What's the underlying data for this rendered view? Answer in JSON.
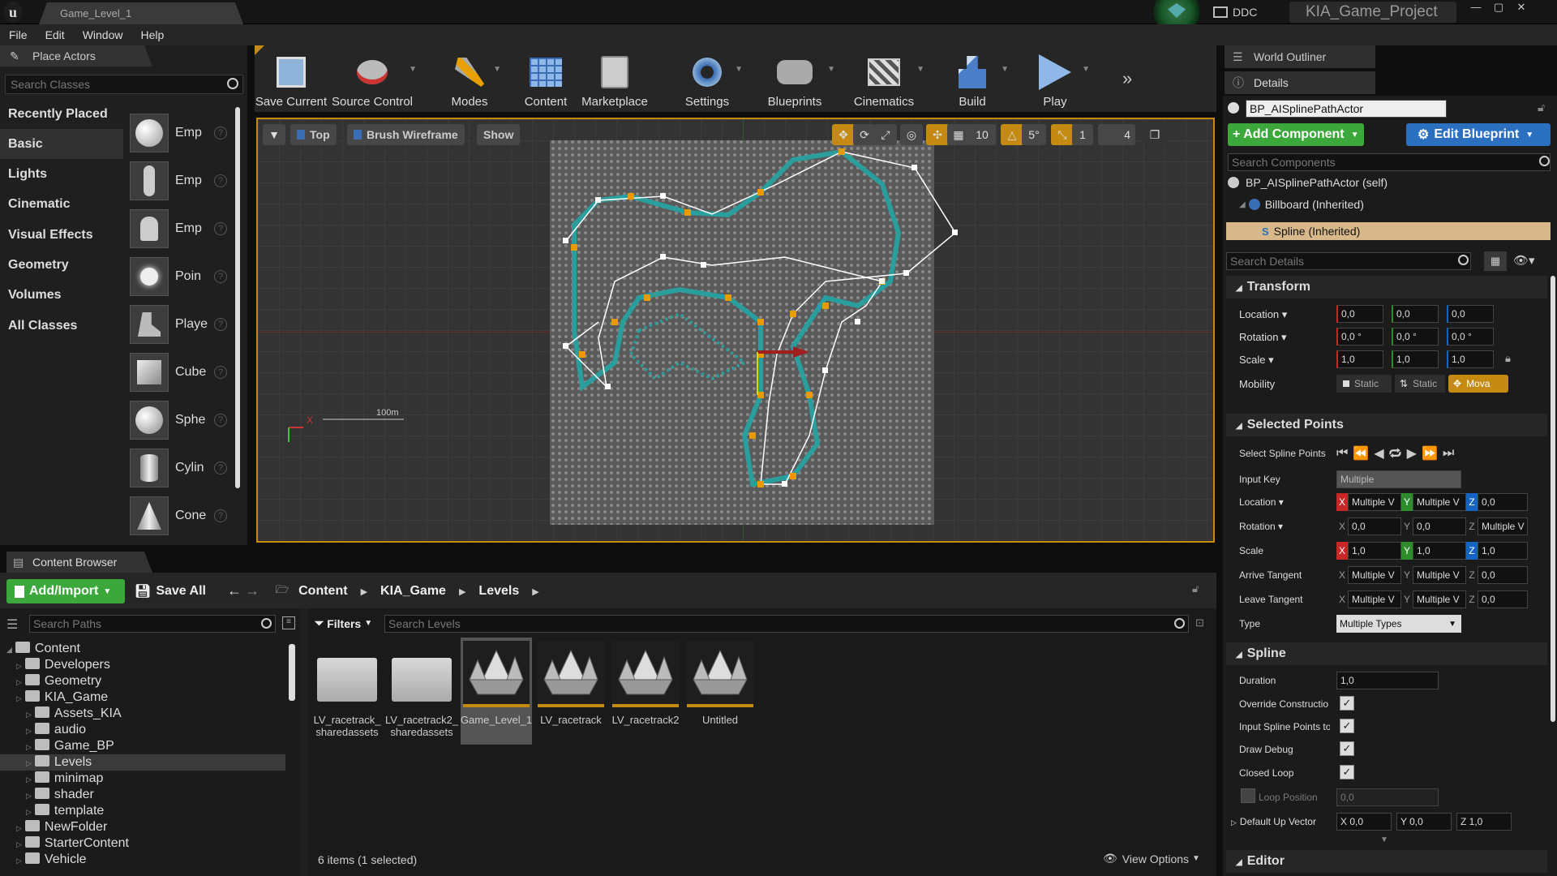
{
  "title_bar": {
    "doc_tab": "Game_Level_1",
    "ddc": "DDC",
    "project": "KIA_Game_Project"
  },
  "menu": [
    "File",
    "Edit",
    "Window",
    "Help"
  ],
  "place_actors": {
    "tab": "Place Actors",
    "search_placeholder": "Search Classes",
    "categories": [
      "Recently Placed",
      "Basic",
      "Lights",
      "Cinematic",
      "Visual Effects",
      "Geometry",
      "Volumes",
      "All Classes"
    ],
    "active_category": "Basic",
    "actors": [
      "Emp",
      "Emp",
      "Emp",
      "Poin",
      "Playe",
      "Cube",
      "Sphe",
      "Cylin",
      "Cone"
    ]
  },
  "toolbar": {
    "items": [
      "Save Current",
      "Source Control",
      "Modes",
      "Content",
      "Marketplace",
      "Settings",
      "Blueprints",
      "Cinematics",
      "Build",
      "Play"
    ]
  },
  "viewport": {
    "view_mode": "Top",
    "render_mode": "Brush Wireframe",
    "show": "Show",
    "grid_snap": "10",
    "rot_snap": "5°",
    "scale_snap": "1",
    "cam_speed": "4",
    "scale_label": "100m",
    "axis_x": "X"
  },
  "right": {
    "outliner_tab": "World Outliner",
    "details_tab": "Details",
    "actor_name": "BP_AISplinePathActor",
    "add_component": "+ Add Component",
    "edit_blueprint": "Edit Blueprint",
    "search_components": "Search Components",
    "components": [
      "BP_AISplinePathActor (self)",
      "Billboard (Inherited)",
      "Spline (Inherited)"
    ],
    "search_details": "Search Details",
    "transform": {
      "title": "Transform",
      "location_label": "Location",
      "rotation_label": "Rotation",
      "scale_label": "Scale",
      "mobility_label": "Mobility",
      "location": [
        "0,0",
        "0,0",
        "0,0"
      ],
      "rotation": [
        "0,0 °",
        "0,0 °",
        "0,0 °"
      ],
      "scale": [
        "1,0",
        "1,0",
        "1,0"
      ],
      "mobility": [
        "Static",
        "Static",
        "Mova"
      ]
    },
    "selected_points": {
      "title": "Selected Points",
      "select_label": "Select Spline Points",
      "input_key_label": "Input Key",
      "input_key": "Multiple",
      "location_label": "Location",
      "rotation_label": "Rotation",
      "scale_label": "Scale",
      "arrive_label": "Arrive Tangent",
      "leave_label": "Leave Tangent",
      "type_label": "Type",
      "location": [
        "Multiple V",
        "Multiple V",
        "0,0"
      ],
      "rotation": [
        "0,0",
        "0,0",
        "Multiple V"
      ],
      "scale": [
        "1,0",
        "1,0",
        "1,0"
      ],
      "arrive": [
        "Multiple V",
        "Multiple V",
        "0,0"
      ],
      "leave": [
        "Multiple V",
        "Multiple V",
        "0,0"
      ],
      "type": "Multiple Types"
    },
    "spline": {
      "title": "Spline",
      "duration_label": "Duration",
      "duration": "1,0",
      "override_label": "Override Constructio",
      "input_points_label": "Input Spline Points to",
      "draw_debug_label": "Draw Debug",
      "closed_loop_label": "Closed Loop",
      "loop_position_label": "Loop Position",
      "loop_position": "0,0",
      "up_vector_label": "Default Up Vector",
      "up_vector": [
        "X 0,0",
        "Y 0,0",
        "Z 1,0"
      ]
    },
    "editor": {
      "title": "Editor"
    }
  },
  "content_browser": {
    "tab": "Content Browser",
    "add_import": "Add/Import",
    "save_all": "Save All",
    "breadcrumbs": [
      "Content",
      "KIA_Game",
      "Levels"
    ],
    "search_paths": "Search Paths",
    "filters": "Filters",
    "search_levels": "Search Levels",
    "tree": [
      {
        "label": "Content",
        "indent": 0,
        "sel": false
      },
      {
        "label": "Developers",
        "indent": 1,
        "sel": false
      },
      {
        "label": "Geometry",
        "indent": 1,
        "sel": false
      },
      {
        "label": "KIA_Game",
        "indent": 1,
        "sel": false
      },
      {
        "label": "Assets_KIA",
        "indent": 2,
        "sel": false
      },
      {
        "label": "audio",
        "indent": 2,
        "sel": false
      },
      {
        "label": "Game_BP",
        "indent": 2,
        "sel": false
      },
      {
        "label": "Levels",
        "indent": 2,
        "sel": true
      },
      {
        "label": "minimap",
        "indent": 2,
        "sel": false
      },
      {
        "label": "shader",
        "indent": 2,
        "sel": false
      },
      {
        "label": "template",
        "indent": 2,
        "sel": false
      },
      {
        "label": "NewFolder",
        "indent": 1,
        "sel": false
      },
      {
        "label": "StarterContent",
        "indent": 1,
        "sel": false
      },
      {
        "label": "Vehicle",
        "indent": 1,
        "sel": false
      }
    ],
    "assets": [
      {
        "name": "LV_racetrack_ sharedassets",
        "kind": "folder",
        "sel": false
      },
      {
        "name": "LV_racetrack2_ sharedassets",
        "kind": "folder",
        "sel": false
      },
      {
        "name": "Game_Level_1",
        "kind": "level",
        "sel": true
      },
      {
        "name": "LV_racetrack",
        "kind": "level",
        "sel": false
      },
      {
        "name": "LV_racetrack2",
        "kind": "level",
        "sel": false
      },
      {
        "name": "Untitled",
        "kind": "level",
        "sel": false
      }
    ],
    "status": "6 items (1 selected)",
    "view_options": "View Options"
  },
  "colors": {
    "accent_orange": "#c48a12",
    "green_button": "#3ca83c",
    "blue_button": "#2a6fc0",
    "spline_teal": "#2a9d9d"
  }
}
